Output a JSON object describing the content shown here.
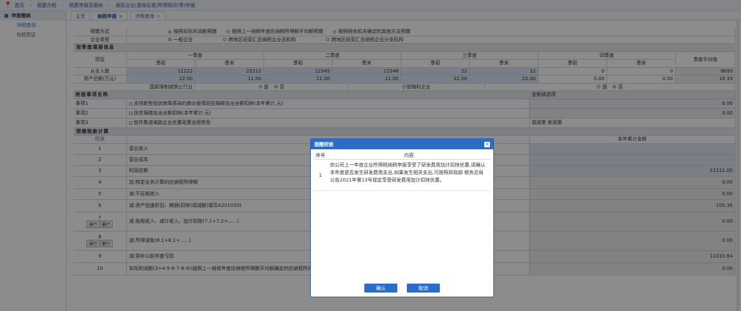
{
  "breadcrumb": [
    "首页",
    "我要办税",
    "税费申报及缴纳",
    "居民企业(查账征收)所得税月(季)申报"
  ],
  "sidebar": {
    "head": "申报缴纳",
    "items": [
      "涉税查询",
      "充税凭证"
    ]
  },
  "tabs": [
    {
      "label": "主页"
    },
    {
      "label": "纳税申报"
    },
    {
      "label": "涉税查询"
    }
  ],
  "form": {
    "prepay_label": "预缴方式",
    "prepay_opts": [
      "按照实际利润额预缴",
      "按照上一纳税年度应纳税所得额平均额预缴",
      "按照税务机关确定的其他方法预缴"
    ],
    "ent_label": "企业类型",
    "ent_opts": [
      "一般企业",
      "跨地区经营汇总纳税企业总机构",
      "跨地区经营汇总纳税企业分支机构"
    ],
    "sect1": "按季度填报信息",
    "item_col": "项目",
    "quarters": [
      "一季度",
      "二季度",
      "三季度",
      "四季度"
    ],
    "qsub": [
      "季初",
      "季末"
    ],
    "avg_col": "季度平均值",
    "emp_label": "从业人数",
    "emp_vals": [
      "11222",
      "22211",
      "12345",
      "12346",
      "22",
      "11",
      "0",
      "0"
    ],
    "emp_avg": "9693",
    "asset_label": "资产总额(万元)",
    "asset_vals": [
      "22.00",
      "11.00",
      "11.00",
      "11.00",
      "22.00",
      "22.00",
      "0.00",
      "0.00"
    ],
    "asset_avg": "18.33",
    "restrict_label": "国家限制或禁止行业",
    "small_label": "小型微利企业",
    "yes": "是",
    "no": "否",
    "sect2": "附报事项名称",
    "amount_col": "金额或选项",
    "items": [
      {
        "label": "事项1",
        "text": "支持新型冠状病毒感染的肺炎疫情防控捐赠支出全额扣除(本年累计,元)",
        "val": "0.00"
      },
      {
        "label": "事项2",
        "text": "扶贫捐赠支出全额扣除(本年累计,元)",
        "val": "0.00"
      },
      {
        "label": "事项3",
        "text": "软件集成电路企业优惠政策适用类型",
        "val": "原政策  新政策"
      }
    ],
    "sect3": "预缴税款计算",
    "line_col": "行次",
    "ytd_col": "本年累计金额",
    "op_btn": "操行",
    "del_btn": "删行",
    "lines": [
      {
        "n": "1",
        "text": "营业收入",
        "val": ""
      },
      {
        "n": "2",
        "text": "营业成本",
        "val": ""
      },
      {
        "n": "3",
        "text": "利润总额",
        "val": "11111.00"
      },
      {
        "n": "4",
        "text": "加:特定业务计算的应纳税所得额",
        "val": "0.00"
      },
      {
        "n": "5",
        "text": "减:不征税收入",
        "val": "0.00"
      },
      {
        "n": "6",
        "text": "减:资产加速折旧、摊销(扣除)调减额(填写A201020)",
        "val": "100.36"
      },
      {
        "n": "7",
        "text": "减:免税收入、减计收入、加计扣除(7.1+7.2+......)",
        "val": "0.00"
      },
      {
        "n": "8",
        "text": "减:所得减免(8.1+8.2+......)",
        "val": "0.00"
      },
      {
        "n": "9",
        "text": "减:弥补以前年度亏损",
        "val": "11010.64"
      },
      {
        "n": "10",
        "text": "实际利润额(3+4-5-6-7-8-9)\\按照上一纳税年度应纳税所得额平均额确定的应纳税所得额",
        "val": "0.00"
      }
    ]
  },
  "dialog": {
    "title": "提醒校验",
    "col_no": "序号",
    "col_content": "内容",
    "rows": [
      {
        "no": "1",
        "text": "你公司上一年度企业所得税纳税申报享受了研发费用加计扣除优惠,请确认本年度是否发生研发费用支出,如果发生相关支出,可按照财政部 税务总局公告2021年第13号规定享受研发费用加计扣除优惠。"
      }
    ],
    "ok": "确认",
    "cancel": "取消"
  }
}
